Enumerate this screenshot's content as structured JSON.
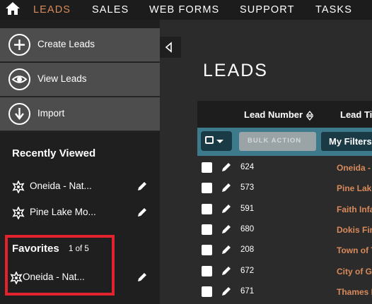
{
  "nav": {
    "home_icon": "home-icon",
    "items": [
      "LEADS",
      "SALES",
      "WEB FORMS",
      "SUPPORT",
      "TASKS"
    ],
    "active_color": "#d98a5b"
  },
  "sidebar": {
    "actions": [
      {
        "label": "Create Leads",
        "icon": "plus-circle-icon"
      },
      {
        "label": "View Leads",
        "icon": "eye-circle-icon"
      },
      {
        "label": "Import",
        "icon": "download-circle-icon"
      }
    ],
    "recently_viewed": {
      "title": "Recently Viewed",
      "items": [
        "Oneida - Nat...",
        "Pine Lake Mo..."
      ]
    },
    "favorites": {
      "title": "Favorites",
      "count": "1 of 5",
      "items": [
        "Oneida - Nat..."
      ]
    },
    "highlight_color": "#e2222c"
  },
  "main": {
    "page_title": "LEADS",
    "columns": [
      "Lead Number",
      "Lead Tit"
    ],
    "bulk_action_label": "BULK ACTION",
    "filters_label": "My Filters",
    "toolbar_color": "#3c7a8c",
    "rows": [
      {
        "number": "624",
        "title": "Oneida - "
      },
      {
        "number": "573",
        "title": "Pine Lake"
      },
      {
        "number": "591",
        "title": "Faith Infa"
      },
      {
        "number": "680",
        "title": "Dokis Firs"
      },
      {
        "number": "208",
        "title": "Town of T"
      },
      {
        "number": "672",
        "title": "City of Gu"
      },
      {
        "number": "671",
        "title": "Thames R"
      }
    ]
  }
}
